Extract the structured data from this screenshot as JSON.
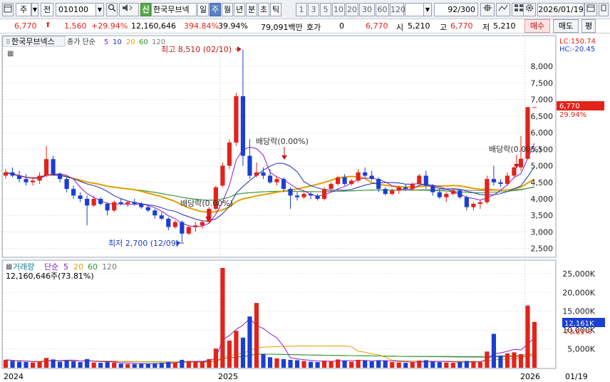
{
  "toolbar": {
    "market": "주",
    "type": "전",
    "code": "010100",
    "stock_badge": "신",
    "stock_name": "한국무브넥",
    "periods": [
      "일",
      "주",
      "월",
      "년",
      "분",
      "초",
      "틱"
    ],
    "active_period": "주",
    "minute_steps": [
      "1",
      "3",
      "5",
      "10",
      "20",
      "30",
      "60",
      "120"
    ],
    "count": "92/300",
    "date": "2026/01/19"
  },
  "quote": {
    "price": "6,770",
    "change": "1,560",
    "change_pct": "+29.94%",
    "volume": "12,160,646",
    "vol_ratio": "394.84%",
    "turnover": "39.94%",
    "amount": "79,091백만",
    "hoga_label": "호가",
    "hoga": "0",
    "ask": "6,770",
    "open_label": "시",
    "open": "5,210",
    "high_label": "고",
    "high": "6,770",
    "low_label": "저",
    "low": "5,210",
    "buy_btn": "매수",
    "sell_btn": "매도",
    "eval_btn": "평"
  },
  "colors": {
    "up": "#e2231a",
    "down": "#1b3fd1",
    "ma5": "#8a1cc8",
    "ma10": "#1c2fb0",
    "ma20": "#e0a000",
    "ma60": "#2a9a2a",
    "ma120": "#7a7a7a",
    "accent": "#5b7fc6"
  },
  "price_panel": {
    "title": "한국무브넥스",
    "legend": {
      "prefix": "종가 단순",
      "ma": [
        "5",
        "10",
        "20",
        "60",
        "120"
      ]
    },
    "lc": "LC:150.74",
    "hc": "HC:-20.45",
    "current_tag": "6,770",
    "current_pct": "29.94%",
    "high_annotation": "최고 8,510 (02/10)",
    "low_annotation": "최저 2,700 (12/09)",
    "dividend_label": "배당락(0.00%)",
    "y_ticks": [
      "8,000",
      "7,500",
      "7,000",
      "6,500",
      "6,000",
      "5,500",
      "5,000",
      "4,500",
      "4,000",
      "3,500",
      "3,000",
      "2,500"
    ]
  },
  "volume_panel": {
    "legend": {
      "name": "거래량",
      "prefix": "단순",
      "ma": [
        "5",
        "20",
        "60",
        "120"
      ]
    },
    "info": "12,160,646주(73.81%)",
    "current_tag": "12,161K",
    "current_pct": "73.81%",
    "y_ticks": [
      "25,000K",
      "20,000K",
      "15,000K",
      "10,000K",
      "5,000K"
    ]
  },
  "x_axis": {
    "labels": [
      "2024",
      "2025",
      "2026"
    ],
    "last": "01/19"
  },
  "chart_data": {
    "type": "candlestick",
    "period": "weekly",
    "price_range": [
      2300,
      8800
    ],
    "volume_range": [
      0,
      28000
    ],
    "candles": [
      [
        4700,
        4900,
        4600,
        4800,
        2100
      ],
      [
        4800,
        4950,
        4650,
        4700,
        1800
      ],
      [
        4700,
        4850,
        4500,
        4600,
        1600
      ],
      [
        4600,
        4750,
        4400,
        4500,
        1500
      ],
      [
        4500,
        4650,
        4400,
        4550,
        1400
      ],
      [
        4550,
        4800,
        4450,
        4700,
        1700
      ],
      [
        4700,
        5600,
        4650,
        5200,
        2600
      ],
      [
        5200,
        5300,
        4700,
        4750,
        2200
      ],
      [
        4750,
        4800,
        4500,
        4600,
        1600
      ],
      [
        4600,
        4650,
        4200,
        4300,
        1900
      ],
      [
        4300,
        4400,
        4000,
        4100,
        1700
      ],
      [
        4100,
        4200,
        3900,
        4000,
        1500
      ],
      [
        4000,
        4100,
        3200,
        3800,
        2300
      ],
      [
        3800,
        4100,
        3750,
        4000,
        1400
      ],
      [
        4000,
        4050,
        3800,
        3850,
        1300
      ],
      [
        3850,
        3900,
        3500,
        3650,
        1500
      ],
      [
        3650,
        3950,
        3600,
        3900,
        1400
      ],
      [
        3900,
        4000,
        3800,
        3850,
        1100
      ],
      [
        3850,
        3950,
        3750,
        3900,
        1000
      ],
      [
        3900,
        4000,
        3800,
        3850,
        1000
      ],
      [
        3850,
        3900,
        3700,
        3750,
        1100
      ],
      [
        3750,
        3800,
        3600,
        3650,
        1100
      ],
      [
        3650,
        3700,
        3400,
        3500,
        1200
      ],
      [
        3500,
        3600,
        3350,
        3400,
        1300
      ],
      [
        3400,
        3450,
        3050,
        3150,
        1500
      ],
      [
        3150,
        3350,
        3100,
        3300,
        1400
      ],
      [
        3300,
        3350,
        2700,
        2950,
        2100
      ],
      [
        2950,
        3200,
        2900,
        3150,
        1800
      ],
      [
        3150,
        3300,
        3000,
        3200,
        1700
      ],
      [
        3200,
        3350,
        3100,
        3300,
        1600
      ],
      [
        3300,
        3750,
        3250,
        3700,
        2300
      ],
      [
        3700,
        4400,
        3650,
        4350,
        5100
      ],
      [
        4400,
        5100,
        4350,
        5000,
        26500
      ],
      [
        5000,
        5800,
        4900,
        5700,
        7200
      ],
      [
        5700,
        7200,
        5600,
        7100,
        9800
      ],
      [
        7100,
        8510,
        5000,
        5300,
        8000
      ],
      [
        5300,
        5800,
        4600,
        4700,
        13600
      ],
      [
        4700,
        5100,
        4650,
        4800,
        17200
      ],
      [
        4800,
        4950,
        4600,
        4700,
        3600
      ],
      [
        4700,
        4900,
        4450,
        4500,
        2800
      ],
      [
        4500,
        4700,
        4400,
        4600,
        2500
      ],
      [
        4600,
        4650,
        4200,
        4300,
        2300
      ],
      [
        4300,
        4350,
        3700,
        4100,
        2100
      ],
      [
        4100,
        4200,
        3950,
        4050,
        2000
      ],
      [
        4050,
        4200,
        4000,
        4150,
        1800
      ],
      [
        4150,
        4200,
        4000,
        4100,
        1600
      ],
      [
        4100,
        4150,
        3950,
        4000,
        1500
      ],
      [
        4000,
        4350,
        3950,
        4300,
        1900
      ],
      [
        4300,
        4500,
        4250,
        4450,
        1800
      ],
      [
        4450,
        4700,
        4400,
        4650,
        2200
      ],
      [
        4650,
        4750,
        4400,
        4450,
        1900
      ],
      [
        4450,
        4600,
        4400,
        4550,
        1600
      ],
      [
        4550,
        4900,
        4500,
        4800,
        2100
      ],
      [
        4800,
        4950,
        4650,
        4700,
        1900
      ],
      [
        4700,
        4850,
        4550,
        4600,
        1700
      ],
      [
        4600,
        4650,
        4200,
        4300,
        2000
      ],
      [
        4300,
        4350,
        4100,
        4150,
        1800
      ],
      [
        4150,
        4300,
        4100,
        4250,
        1500
      ],
      [
        4250,
        4400,
        4150,
        4350,
        1400
      ],
      [
        4350,
        4450,
        4250,
        4300,
        1300
      ],
      [
        4300,
        4500,
        4250,
        4450,
        1500
      ],
      [
        4450,
        4750,
        4400,
        4700,
        1900
      ],
      [
        4700,
        4850,
        4300,
        4400,
        2000
      ],
      [
        4400,
        4450,
        4100,
        4200,
        1600
      ],
      [
        4200,
        4300,
        4000,
        4050,
        1500
      ],
      [
        4050,
        4200,
        3900,
        4150,
        1400
      ],
      [
        4150,
        4300,
        4100,
        4250,
        1300
      ],
      [
        4250,
        4300,
        4000,
        4050,
        1600
      ],
      [
        4050,
        4100,
        3650,
        3750,
        1800
      ],
      [
        3750,
        3900,
        3650,
        3850,
        1700
      ],
      [
        3850,
        3950,
        3700,
        3900,
        1500
      ],
      [
        3900,
        4700,
        3850,
        4600,
        4300
      ],
      [
        4600,
        5000,
        4400,
        4500,
        9000
      ],
      [
        4500,
        4600,
        4350,
        4450,
        3200
      ],
      [
        4450,
        4800,
        4400,
        4700,
        3800
      ],
      [
        4700,
        5000,
        4650,
        4950,
        4100
      ],
      [
        4950,
        5900,
        4850,
        5210,
        3600
      ],
      [
        5210,
        6770,
        5210,
        6770,
        16500
      ],
      [
        6770,
        6770,
        6770,
        6770,
        12161
      ]
    ]
  }
}
